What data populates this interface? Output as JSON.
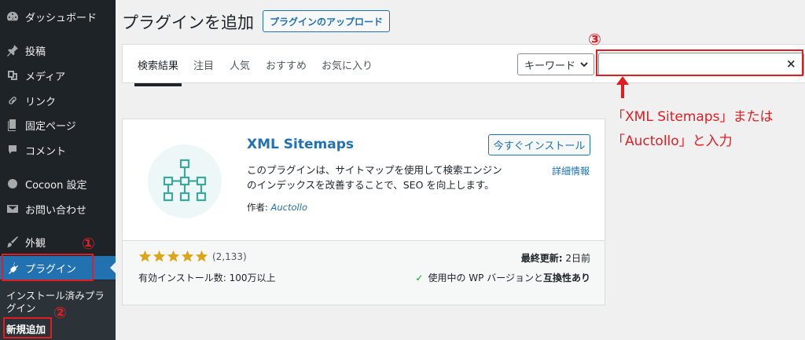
{
  "sidebar": {
    "items": [
      {
        "label": "ダッシュボード",
        "icon": "dashboard-icon"
      },
      {
        "label": "投稿",
        "icon": "pin-icon"
      },
      {
        "label": "メディア",
        "icon": "media-icon"
      },
      {
        "label": "リンク",
        "icon": "link-icon"
      },
      {
        "label": "固定ページ",
        "icon": "page-icon"
      },
      {
        "label": "コメント",
        "icon": "comment-icon"
      },
      {
        "label": "Cocoon 設定",
        "icon": "cocoon-icon"
      },
      {
        "label": "お問い合わせ",
        "icon": "mail-icon"
      },
      {
        "label": "外観",
        "icon": "brush-icon"
      },
      {
        "label": "プラグイン",
        "icon": "plugin-icon"
      }
    ],
    "submenu": {
      "installed_line1": "インストール済みプラ",
      "installed_line2": "グイン",
      "add_new": "新規追加"
    }
  },
  "header": {
    "title": "プラグインを追加",
    "upload_label": "プラグインのアップロード"
  },
  "filter": {
    "tabs": [
      "検索結果",
      "注目",
      "人気",
      "おすすめ",
      "お気に入り"
    ],
    "select_value": "キーワード",
    "search_value": "",
    "clear_symbol": "×"
  },
  "plugin": {
    "name": "XML Sitemaps",
    "install_label": "今すぐインストール",
    "details_label": "詳細情報",
    "description": "このプラグインは、サイトマップを使用して検索エンジンのインデックスを改善することで、SEO を向上します。",
    "author_label": "作者:",
    "author_name": "Auctollo",
    "rating_count": "(2,133)",
    "stars": 5,
    "installs_text": "有効インストール数: 100万以上",
    "updated_label": "最終更新:",
    "updated_value": "2日前",
    "compat_prefix": "使用中の WP バージョンと",
    "compat_bold": "互換性あり"
  },
  "annotations": {
    "n1": "①",
    "n2": "②",
    "n3": "③",
    "note_line1": "「XML Sitemaps」または",
    "note_line2": "「Auctollo」と入力"
  },
  "colors": {
    "sidebar_bg": "#1d2327",
    "accent": "#2271b1",
    "annotation_red": "#e11d21",
    "star": "#dba617"
  }
}
